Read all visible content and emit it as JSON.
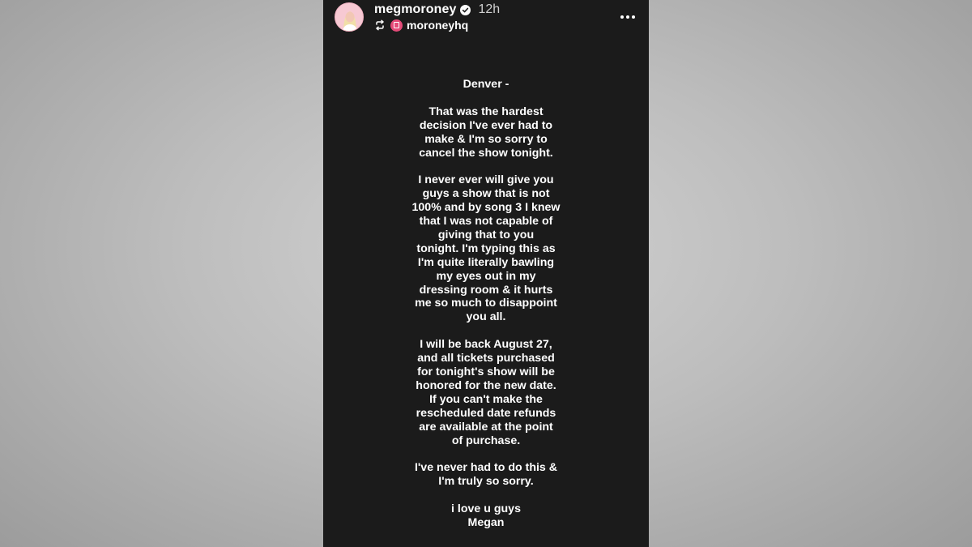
{
  "post": {
    "username": "megmoroney",
    "verified_icon": "verified-badge-icon",
    "time_ago": "12h",
    "repost_icon": "repost-icon",
    "reposted_from": "moroneyhq",
    "more_icon": "more-options-icon",
    "colors": {
      "story_background": "#1b1b1b",
      "text": "#ffffff",
      "page_background": "#bdbdbd"
    }
  },
  "message": {
    "paragraphs": [
      [
        "Denver -"
      ],
      [
        "That was the hardest",
        "decision I've ever had to",
        "make & I'm so sorry to",
        "cancel the show tonight."
      ],
      [
        "I never ever will give you",
        "guys a show that is not",
        "100% and by song 3 I knew",
        "that I was not capable of",
        "giving that to you",
        "tonight. I'm typing this as",
        "I'm quite literally bawling",
        "my eyes out in my",
        "dressing room & it hurts",
        "me so much to disappoint",
        "you all."
      ],
      [
        "I will be back August 27,",
        "and all tickets purchased",
        "for tonight's show will be",
        "honored for the new date.",
        "If you can't make the",
        "rescheduled date refunds",
        "are available at the point",
        "of purchase."
      ],
      [
        "I've never had to do this &",
        "I'm truly so sorry."
      ],
      [
        "i love u guys",
        "Megan"
      ]
    ]
  }
}
